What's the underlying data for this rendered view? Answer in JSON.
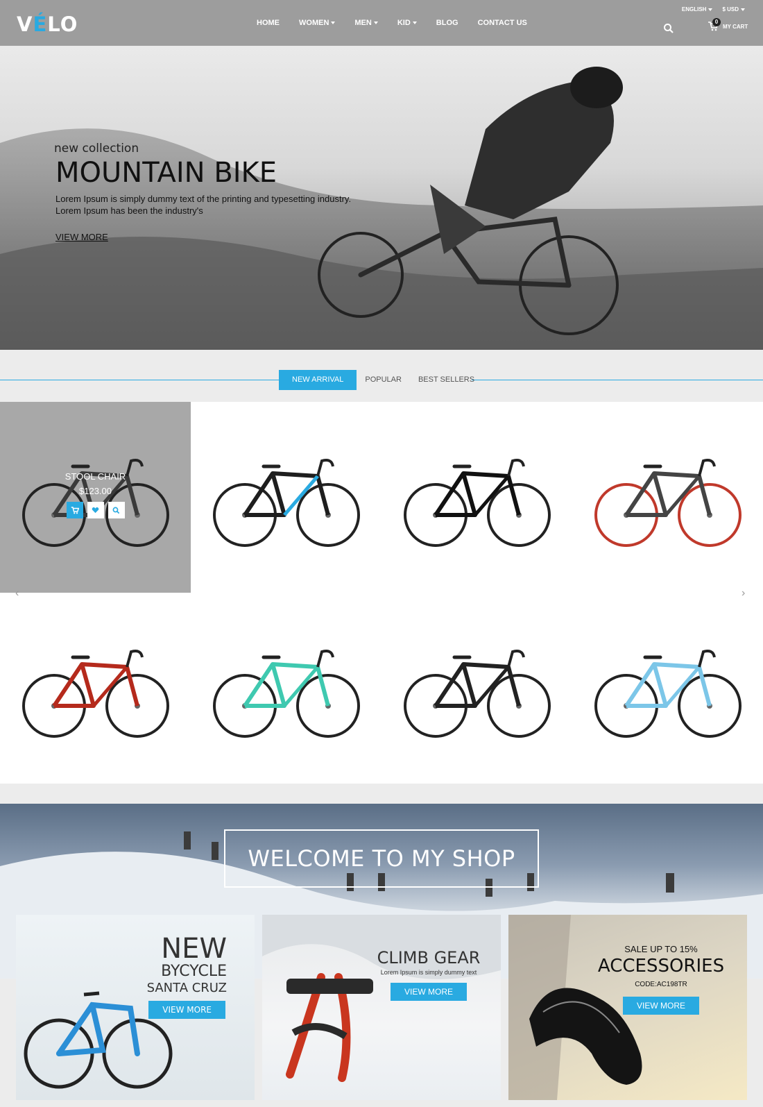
{
  "header": {
    "logo": {
      "pre": "V",
      "accent": "É",
      "post": "LO"
    },
    "language": "ENGLISH",
    "currency": "$ USD",
    "nav": [
      "HOME",
      "WOMEN",
      "MEN",
      "KID",
      "BLOG",
      "CONTACT US"
    ],
    "cart_count": "0",
    "cart_label": "MY CART"
  },
  "hero": {
    "subtitle": "new collection",
    "title": "MOUNTAIN BIKE",
    "description": "Lorem Ipsum is simply dummy text of the printing and typesetting industry. Lorem Ipsum has been the industry's",
    "link": "VIEW MORE"
  },
  "tabs": [
    "NEW ARRIVAL",
    "POPULAR",
    "BEST SELLERS"
  ],
  "products": {
    "hover_item": {
      "name": "STOOL CHAIR",
      "price": "$123.00"
    },
    "items": [
      {
        "frame": "#3a3a3a"
      },
      {
        "frame": "#1e1e1e",
        "accent": "#29aae1"
      },
      {
        "frame": "#111111"
      },
      {
        "frame": "#444444",
        "accent": "#c0392b"
      },
      {
        "frame": "#b52a1c"
      },
      {
        "frame": "#3fc9b0"
      },
      {
        "frame": "#222222"
      },
      {
        "frame": "#7cc6e8"
      }
    ]
  },
  "welcome": {
    "title": "WELCOME TO MY SHOP"
  },
  "promos": {
    "card1": {
      "line1": "NEW",
      "line2": "BYCYCLE",
      "line3": "SANTA CRUZ",
      "button": "VIEW MORE"
    },
    "card2": {
      "title": "CLIMB GEAR",
      "subtitle": "Lorem Ipsum is simply dummy text",
      "button": "VIEW MORE"
    },
    "card3": {
      "sale": "SALE UP TO 15%",
      "title": "ACCESSORIES",
      "code": "CODE:AC198TR",
      "button": "VIEW MORE"
    }
  },
  "colors": {
    "accent": "#29aae1",
    "header": "#9d9d9d"
  }
}
